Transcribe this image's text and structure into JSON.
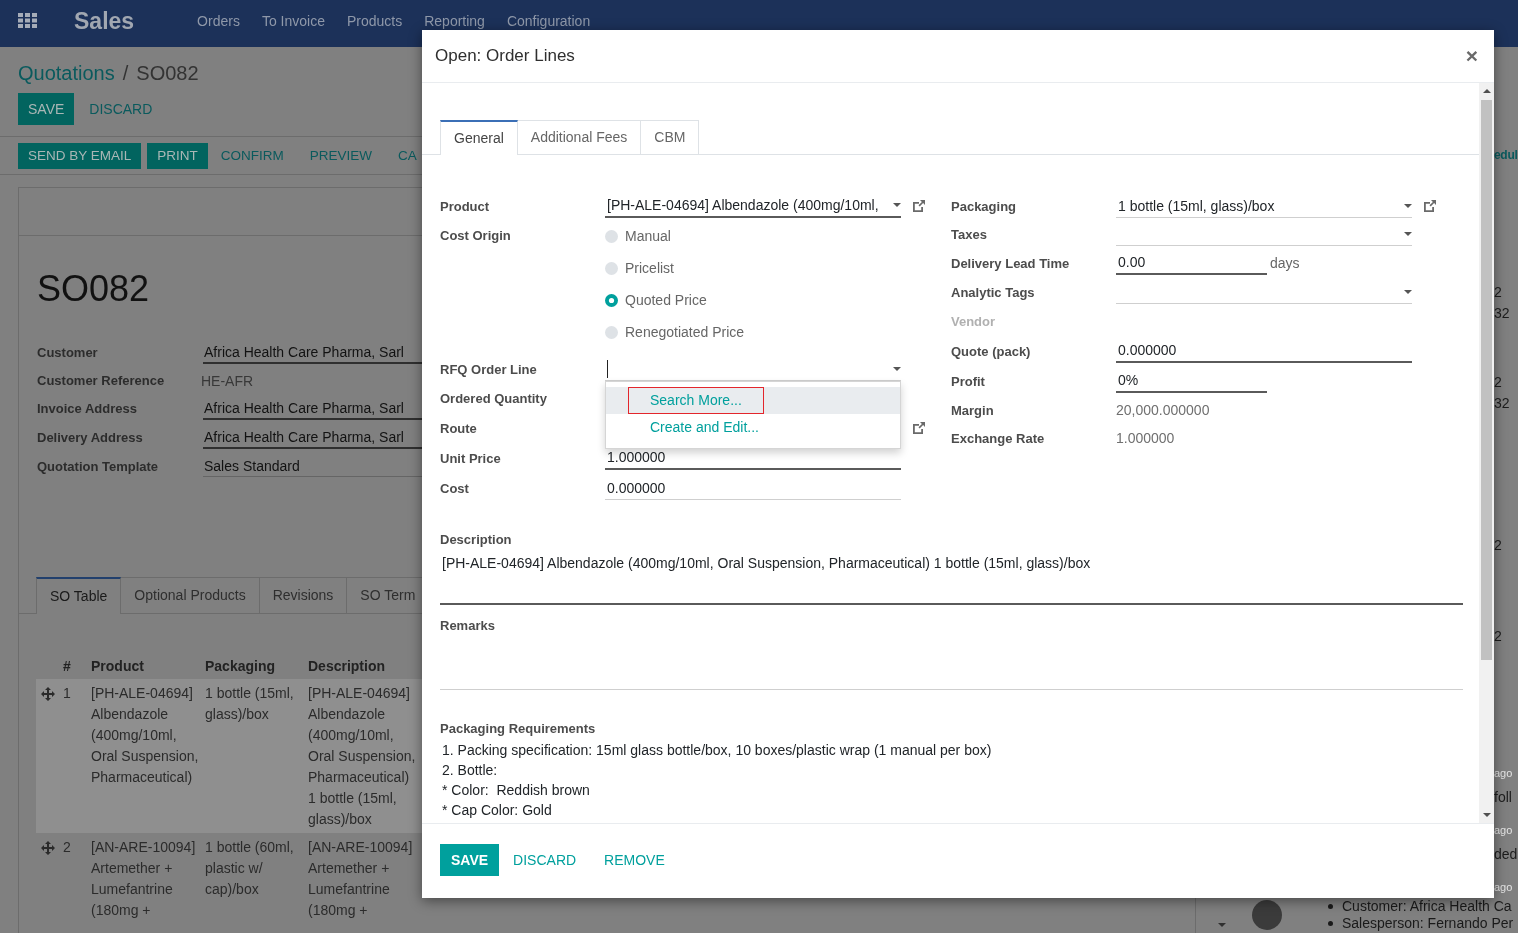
{
  "navbar": {
    "app_name": "Sales",
    "menus": [
      "Orders",
      "To Invoice",
      "Products",
      "Reporting",
      "Configuration"
    ]
  },
  "breadcrumbs": [
    {
      "label": "Quotations",
      "link": true
    },
    {
      "label": "SO082",
      "link": false
    }
  ],
  "breadcrumb_separator": "/",
  "control_buttons": [
    {
      "label": "SAVE",
      "kind": "primary"
    },
    {
      "label": "DISCARD",
      "kind": "link"
    }
  ],
  "status_buttons": [
    {
      "label": "SEND BY EMAIL",
      "kind": "primary"
    },
    {
      "label": "PRINT",
      "kind": "primary"
    },
    {
      "label": "CONFIRM",
      "kind": "link"
    },
    {
      "label": "PREVIEW",
      "kind": "link"
    },
    {
      "label": "CA",
      "kind": "link"
    }
  ],
  "sheet": {
    "title": "SO082",
    "fields": [
      {
        "label": "Customer",
        "kind": "many2one",
        "value": "Africa Health Care Pharma, Sarl",
        "required": true
      },
      {
        "label": "Customer Reference",
        "kind": "readonly",
        "value": "HE-AFR"
      },
      {
        "label": "Invoice Address",
        "kind": "many2one",
        "value": "Africa Health Care Pharma, Sarl",
        "required": true
      },
      {
        "label": "Delivery Address",
        "kind": "many2one",
        "value": "Africa Health Care Pharma, Sarl",
        "required": true
      },
      {
        "label": "Quotation Template",
        "kind": "many2one",
        "value": "Sales Standard",
        "required": false
      }
    ],
    "tabs": [
      {
        "label": "SO Table",
        "selected": true
      },
      {
        "label": "Optional Products",
        "selected": false
      },
      {
        "label": "Revisions",
        "selected": false
      },
      {
        "label": "SO Term",
        "selected": false
      }
    ],
    "table": {
      "columns": [
        "#",
        "Product",
        "Packaging",
        "Description"
      ],
      "rows": [
        {
          "number": "1",
          "product": "[PH-ALE-04694] Albendazole (400mg/10ml, Oral Suspension, Pharmaceutical)",
          "packaging": "1 bottle (15ml, glass)/box",
          "description": "[PH-ALE-04694] Albendazole (400mg/10ml, Oral Suspension, Pharmaceutical) 1 bottle (15ml, glass)/box",
          "selected": true
        },
        {
          "number": "2",
          "product": "[AN-ARE-10094] Artemether + Lumefantrine (180mg +",
          "packaging": "1 bottle (60ml, plastic w/ cap)/box",
          "description": "[AN-ARE-10094] Artemether + Lumefantrine (180mg +",
          "selected": false
        }
      ]
    }
  },
  "chatter": {
    "fragments": [
      {
        "kind": "link",
        "text": "edul"
      },
      {
        "kind": "text",
        "text": "2"
      },
      {
        "kind": "text",
        "text": "32"
      },
      {
        "kind": "text",
        "text": "2"
      },
      {
        "kind": "text",
        "text": "32"
      },
      {
        "kind": "text",
        "text": "2"
      },
      {
        "kind": "text",
        "text": "2"
      },
      {
        "kind": "time",
        "text": "ago"
      },
      {
        "kind": "text",
        "text": "foll"
      },
      {
        "kind": "time",
        "text": "ago"
      },
      {
        "kind": "text",
        "text": "ded"
      },
      {
        "kind": "time",
        "text": "ago"
      }
    ],
    "message_lines": [
      "Customer: Africa Health Ca",
      "Salesperson: Fernando Per"
    ]
  },
  "dialog": {
    "title": "Open: Order Lines",
    "close": "×",
    "tabs": [
      {
        "label": "General",
        "selected": true
      },
      {
        "label": "Additional Fees",
        "selected": false
      },
      {
        "label": "CBM",
        "selected": false
      }
    ],
    "left_fields": [
      {
        "label": "Product",
        "kind": "select",
        "value": "[PH-ALE-04694] Albendazole (400mg/10ml,",
        "required": true,
        "focused": false,
        "disabled": false,
        "open_link": true
      },
      {
        "label": "Cost Origin",
        "kind": "radio",
        "disabled": false,
        "open_link": false,
        "options": [
          {
            "label": "Manual",
            "selected": false
          },
          {
            "label": "Pricelist",
            "selected": false
          },
          {
            "label": "Quoted Price",
            "selected": true
          },
          {
            "label": "Renegotiated Price",
            "selected": false
          }
        ]
      },
      {
        "label": "RFQ Order Line",
        "kind": "select",
        "required": false,
        "focused": true,
        "disabled": false,
        "open_link": false,
        "dropdown": [
          {
            "label": "Search More...",
            "selected": true,
            "annotated": true
          },
          {
            "label": "Create and Edit...",
            "selected": false,
            "annotated": false
          }
        ]
      },
      {
        "label": "Ordered Quantity",
        "kind": "label_only",
        "disabled": false,
        "open_link": false
      },
      {
        "label": "Route",
        "kind": "label_only",
        "disabled": false,
        "open_link": true
      },
      {
        "label": "Unit Price",
        "kind": "input",
        "value": "1.000000",
        "required": true,
        "focused": false,
        "disabled": false,
        "open_link": false
      },
      {
        "label": "Cost",
        "kind": "input",
        "value": "0.000000",
        "required": false,
        "focused": false,
        "disabled": false,
        "open_link": false
      }
    ],
    "right_fields": [
      {
        "label": "Packaging",
        "kind": "select",
        "value": "1 bottle (15ml, glass)/box",
        "required": false,
        "focused": false,
        "disabled": false,
        "open_link": true
      },
      {
        "label": "Taxes",
        "kind": "select",
        "required": false,
        "focused": false,
        "disabled": false,
        "open_link": false
      },
      {
        "label": "Delivery Lead Time",
        "kind": "short_input",
        "value": "0.00",
        "unit": "days",
        "required": true,
        "focused": false,
        "disabled": false,
        "open_link": false
      },
      {
        "label": "Analytic Tags",
        "kind": "select",
        "required": false,
        "focused": false,
        "disabled": false,
        "open_link": false
      },
      {
        "label": "Vendor",
        "kind": "label_only",
        "disabled": true,
        "open_link": false
      },
      {
        "label": "Quote (pack)",
        "kind": "input",
        "value": "0.000000",
        "required": true,
        "focused": false,
        "disabled": false,
        "open_link": false
      },
      {
        "label": "Profit",
        "kind": "short_input",
        "value": "0%",
        "required": true,
        "focused": false,
        "disabled": false,
        "open_link": false
      },
      {
        "label": "Margin",
        "kind": "readonly",
        "value": "20,000.000000",
        "disabled": false,
        "open_link": false
      },
      {
        "label": "Exchange Rate",
        "kind": "readonly",
        "value": "1.000000",
        "disabled": false,
        "open_link": false
      }
    ],
    "description": {
      "label": "Description",
      "text": "[PH-ALE-04694] Albendazole (400mg/10ml, Oral Suspension, Pharmaceutical) 1 bottle (15ml, glass)/box"
    },
    "remarks": {
      "label": "Remarks"
    },
    "packaging_requirements": {
      "label": "Packaging Requirements",
      "lines": [
        "1. Packing specification: 15ml glass bottle/box, 10 boxes/plastic wrap (1 manual per box)",
        "2. Bottle:",
        "* Color:  Reddish brown",
        "* Cap Color: Gold"
      ]
    },
    "buttons": [
      {
        "label": "SAVE",
        "kind": "primary"
      },
      {
        "label": "DISCARD",
        "kind": "link"
      },
      {
        "label": "REMOVE",
        "kind": "link"
      }
    ]
  }
}
